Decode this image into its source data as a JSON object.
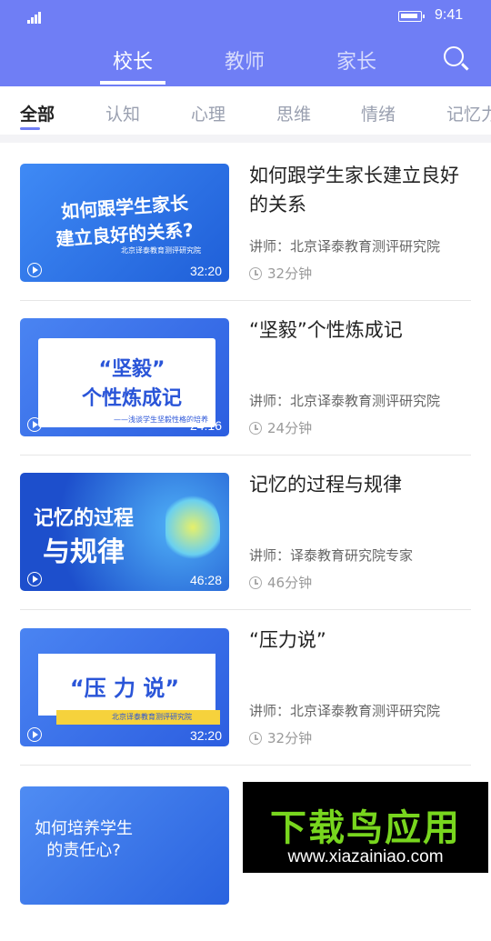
{
  "status": {
    "time": "9:41"
  },
  "top_tabs": [
    "校长",
    "教师",
    "家长"
  ],
  "categories": [
    "全部",
    "认知",
    "心理",
    "思维",
    "情绪",
    "记忆力"
  ],
  "courses": [
    {
      "title": "如何跟学生家长建立良好的关系",
      "lecturer": "讲师：北京译泰教育测评研究院",
      "length": "32分钟",
      "duration": "32:20",
      "thumb_lines": [
        "如何跟学生家长",
        "建立良好的关系?"
      ],
      "thumb_caption": "北京译泰教育测评研究院"
    },
    {
      "title": "“坚毅”个性炼成记",
      "lecturer": "讲师：北京译泰教育测评研究院",
      "length": "24分钟",
      "duration": "24:16",
      "thumb_lines": [
        "“坚毅”",
        "个性炼成记"
      ],
      "thumb_caption": "——浅谈学生坚毅性格的培养"
    },
    {
      "title": "记忆的过程与规律",
      "lecturer": "讲师：译泰教育研究院专家",
      "length": "46分钟",
      "duration": "46:28",
      "thumb_lines": [
        "记忆的过程",
        "与规律"
      ],
      "thumb_caption": ""
    },
    {
      "title": "“压力说”",
      "lecturer": "讲师：北京译泰教育测评研究院",
      "length": "32分钟",
      "duration": "32:20",
      "thumb_lines": [
        "“压 力 说”"
      ],
      "thumb_caption": "北京译泰教育测评研究院"
    },
    {
      "title": "",
      "lecturer": "",
      "length": "",
      "duration": "",
      "thumb_lines": [
        "如何培养学生",
        "的责任心?"
      ],
      "thumb_caption": ""
    }
  ],
  "watermark": {
    "title": "下载鸟应用",
    "url": "www.xiazainiao.com"
  }
}
